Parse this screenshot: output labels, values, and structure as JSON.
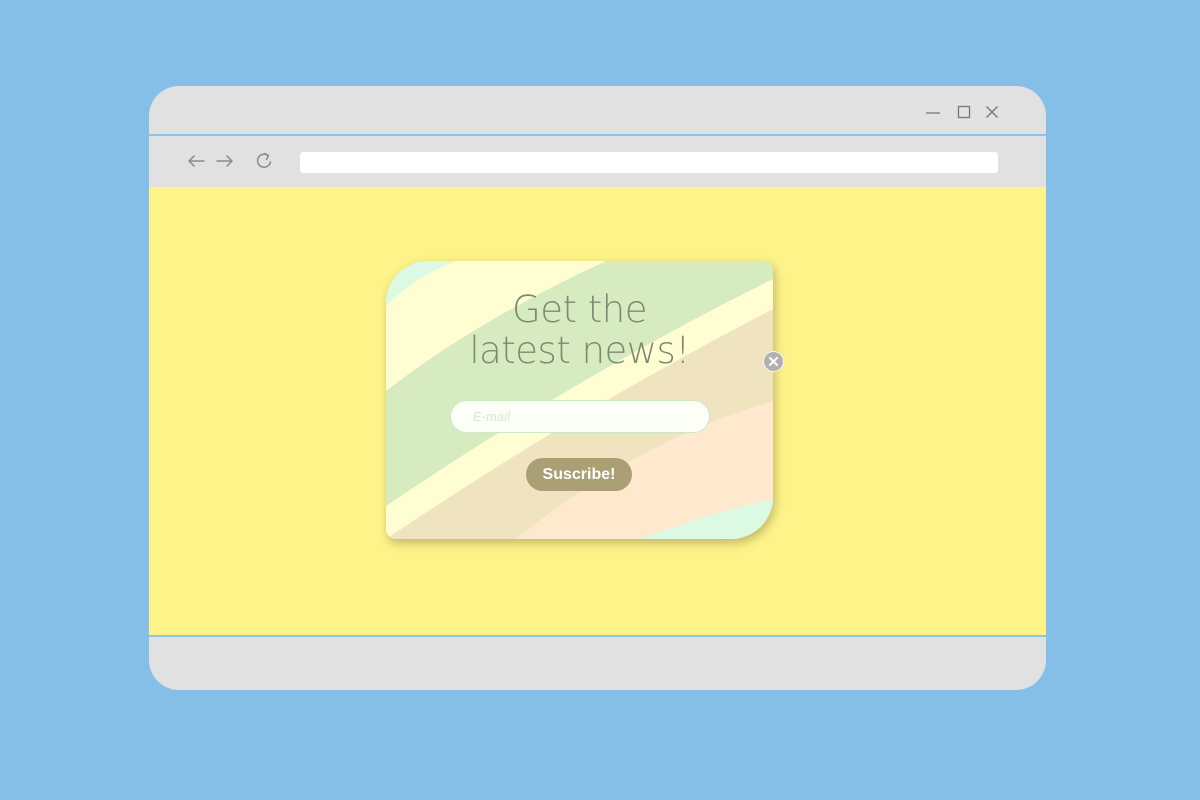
{
  "window": {
    "controls": [
      {
        "name": "minimize",
        "icon": "minimize-icon"
      },
      {
        "name": "maximize",
        "icon": "maximize-icon"
      },
      {
        "name": "close",
        "icon": "close-icon"
      }
    ]
  },
  "toolbar": {
    "back_icon": "arrow-left-icon",
    "forward_icon": "arrow-right-icon",
    "reload_icon": "reload-icon",
    "address_value": ""
  },
  "popup": {
    "title_line1": "Get the",
    "title_line2": "latest news!",
    "email_placeholder": "E-mail",
    "email_value": "",
    "subscribe_label": "Suscribe!",
    "close_icon": "close-icon"
  },
  "colors": {
    "desktop_bg": "#85bfe7",
    "window_chrome": "#e1e1e1",
    "page_bg": "#fef388",
    "divider": "#8cc3ea",
    "button_bg": "#ab9f75",
    "title_text": "#7c8a72"
  }
}
